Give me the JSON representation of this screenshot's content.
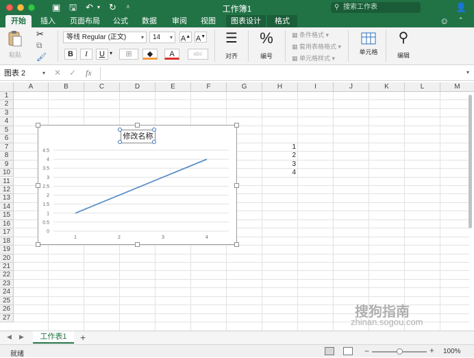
{
  "window": {
    "title": "工作簿1",
    "search_placeholder": "搜索工作表"
  },
  "tabs": [
    "开始",
    "插入",
    "页面布局",
    "公式",
    "数据",
    "审阅",
    "视图",
    "图表设计",
    "格式"
  ],
  "ribbon": {
    "paste_label": "粘贴",
    "font_name": "等线 Regular (正文)",
    "font_size": "14",
    "bold": "B",
    "italic": "I",
    "underline": "U",
    "align_label": "对齐",
    "number_label": "编号",
    "conditional_format": "条件格式",
    "table_format": "套用表格格式",
    "cell_styles": "单元格样式",
    "cells_label": "单元格",
    "edit_label": "编辑"
  },
  "formula_bar": {
    "name_box": "图表 2",
    "fx": "fx"
  },
  "grid": {
    "columns": [
      "A",
      "B",
      "C",
      "D",
      "E",
      "F",
      "G",
      "H",
      "I",
      "J",
      "K",
      "L",
      "M"
    ],
    "rows": [
      "1",
      "2",
      "3",
      "4",
      "5",
      "6",
      "7",
      "8",
      "9",
      "10",
      "11",
      "12",
      "13",
      "14",
      "15",
      "16",
      "17",
      "18",
      "19",
      "20",
      "21",
      "22",
      "23",
      "24",
      "25",
      "26",
      "27"
    ],
    "cells": [
      {
        "ref": "H7",
        "value": "1"
      },
      {
        "ref": "H8",
        "value": "2"
      },
      {
        "ref": "H9",
        "value": "3"
      },
      {
        "ref": "H10",
        "value": "4"
      }
    ]
  },
  "chart": {
    "title": "修改名称"
  },
  "chart_data": {
    "type": "line",
    "title": "修改名称",
    "categories": [
      "1",
      "2",
      "3",
      "4"
    ],
    "values": [
      1,
      2,
      3,
      4
    ],
    "xlabel": "",
    "ylabel": "",
    "ylim": [
      0,
      4.5
    ],
    "yticks": [
      "0",
      "0.5",
      "1",
      "1.5",
      "2",
      "2.5",
      "3",
      "3.5",
      "4",
      "4.5"
    ],
    "grid": true,
    "color": "#5b8fc7"
  },
  "sheets": {
    "active": "工作表1",
    "add": "+"
  },
  "status": {
    "text": "就绪",
    "zoom": "100%",
    "zoom_fraction": 0.5
  },
  "watermark": {
    "brand": "搜狗指南",
    "url": "zhinan.sogou.com"
  },
  "colors": {
    "brand": "#217346",
    "series": "#5b8fc7"
  }
}
